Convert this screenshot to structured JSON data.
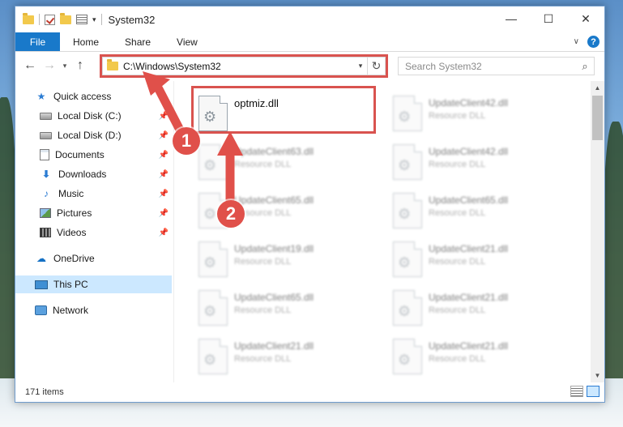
{
  "window": {
    "title": "System32",
    "controls": {
      "minimize": "—",
      "maximize": "☐",
      "close": "✕"
    }
  },
  "ribbon": {
    "tabs": [
      "File",
      "Home",
      "Share",
      "View"
    ],
    "help": "?"
  },
  "navbar": {
    "back": "←",
    "forward": "→",
    "up": "↑",
    "address": "C:\\Windows\\System32",
    "search_placeholder": "Search System32"
  },
  "sidebar": {
    "items": [
      {
        "label": "Quick access",
        "icon": "star-icon",
        "pinned": false
      },
      {
        "label": "Local Disk (C:)",
        "icon": "drive-icon",
        "pinned": true
      },
      {
        "label": "Local Disk (D:)",
        "icon": "drive-icon",
        "pinned": true
      },
      {
        "label": "Documents",
        "icon": "documents-icon",
        "pinned": true
      },
      {
        "label": "Downloads",
        "icon": "download-arrow-icon",
        "pinned": true
      },
      {
        "label": "Music",
        "icon": "music-note-icon",
        "pinned": true
      },
      {
        "label": "Pictures",
        "icon": "pictures-icon",
        "pinned": true
      },
      {
        "label": "Videos",
        "icon": "videos-icon",
        "pinned": true
      },
      {
        "label": "OneDrive",
        "icon": "cloud-icon",
        "pinned": false
      },
      {
        "label": "This PC",
        "icon": "computer-icon",
        "pinned": false
      },
      {
        "label": "Network",
        "icon": "network-icon",
        "pinned": false
      }
    ],
    "selected": "This PC"
  },
  "files": [
    {
      "name": "optmiz.dll",
      "type": "",
      "highlighted": true
    },
    {
      "name": "UpdateClient42.dll",
      "type": "Resource DLL"
    },
    {
      "name": "UpdateClient63.dll",
      "type": "Resource DLL"
    },
    {
      "name": "UpdateClient42.dll",
      "type": "Resource DLL"
    },
    {
      "name": "UpdateClient65.dll",
      "type": "Resource DLL"
    },
    {
      "name": "UpdateClient65.dll",
      "type": "Resource DLL"
    },
    {
      "name": "UpdateClient19.dll",
      "type": "Resource DLL"
    },
    {
      "name": "UpdateClient21.dll",
      "type": "Resource DLL"
    },
    {
      "name": "UpdateClient65.dll",
      "type": "Resource DLL"
    },
    {
      "name": "UpdateClient21.dll",
      "type": "Resource DLL"
    },
    {
      "name": "UpdateClient21.dll",
      "type": "Resource DLL"
    },
    {
      "name": "UpdateClient21.dll",
      "type": "Resource DLL"
    }
  ],
  "status": {
    "item_count": "171 items"
  },
  "annotations": {
    "step1": "1",
    "step2": "2",
    "color": "#e0504a"
  }
}
